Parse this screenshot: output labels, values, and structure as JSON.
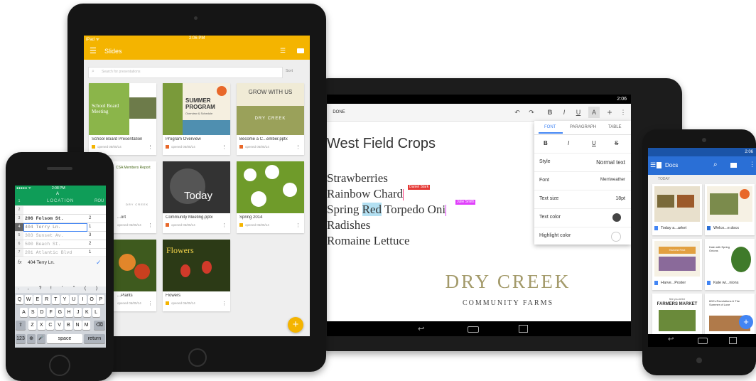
{
  "tablet_android": {
    "status_time": "2:06",
    "toolbar": {
      "done_label": "DONE",
      "bold": "B",
      "italic": "I",
      "underline": "U",
      "text_format": "A",
      "add": "+",
      "more": "⋮",
      "undo": "↶",
      "redo": "↷"
    },
    "document": {
      "title": "West Field Crops",
      "lines": [
        "Strawberries",
        "Rainbow Chard",
        "Spring ",
        "Red",
        " Torpedo Oni",
        "Radishes",
        "Romaine Lettuce"
      ],
      "collab_tags": [
        {
          "name": "Daniel Stark",
          "color": "#e53935"
        },
        {
          "name": "Julie Smith",
          "color": "#e040fb"
        }
      ],
      "logo_main": "DRY CREEK",
      "logo_sub": "COMMUNITY FARMS"
    },
    "format_panel": {
      "tabs": [
        "FONT",
        "PARAGRAPH",
        "TABLE"
      ],
      "style_buttons": [
        "B",
        "I",
        "U",
        "S"
      ],
      "rows": [
        {
          "label": "Style",
          "value": "Normal text"
        },
        {
          "label": "Font",
          "value": "Merriweather"
        },
        {
          "label": "Text size",
          "value": "18pt"
        },
        {
          "label": "Text color",
          "value": ""
        },
        {
          "label": "Highlight color",
          "value": ""
        }
      ]
    },
    "colors": {
      "accent": "#4285f4",
      "tag_red": "#e53935",
      "tag_pink": "#e040fb",
      "logo": "#a39a6a"
    }
  },
  "ipad": {
    "status_left": "iPad ᯤ",
    "status_time": "2:06 PM",
    "app_title": "Slides",
    "search_placeholder": "Search for presentations",
    "sort_label": "Sort",
    "cards": [
      {
        "title": "School Board Presentation",
        "sub": "opened 06/05/14"
      },
      {
        "title": "Program Overview",
        "sub": "opened 06/05/14"
      },
      {
        "title": "Become a C...ember.pptx",
        "sub": "opened 06/05/14"
      },
      {
        "title": "...ort",
        "sub": "opened 06/05/14"
      },
      {
        "title": "Community Meeting.pptx",
        "sub": "opened 06/05/14"
      },
      {
        "title": "Spring 2014",
        "sub": "opened 06/05/14"
      },
      {
        "title": "...Plants",
        "sub": "opened 06/05/14"
      },
      {
        "title": "Flowers",
        "sub": "opened 06/05/14"
      }
    ],
    "thumb_text": {
      "school_board": "School Board Meeting",
      "summer": "SUMMER PROGRAM",
      "summer_sub": "Overview & Schedule",
      "grow": "GROW WITH US",
      "dry_creek": "DRY CREEK",
      "csa": "CSA Members Report",
      "today": "Today",
      "flowers": "Flowers"
    },
    "fab": "+",
    "colors": {
      "accent": "#f4b400"
    }
  },
  "iphone": {
    "carrier": "●●●●● ᯤ",
    "status_time": "2:08 PM",
    "col_a": "A",
    "col_b": "LOCATION",
    "col_c": "ROU",
    "rows": [
      {
        "n": "1",
        "a": "",
        "b": ""
      },
      {
        "n": "2",
        "a": "",
        "b": ""
      },
      {
        "n": "3",
        "a": "206 Folsom St.",
        "b": "2"
      },
      {
        "n": "4",
        "a": "404 Terry Ln.",
        "b": "1"
      },
      {
        "n": "5",
        "a": "303 Sunset Av.",
        "b": "3"
      },
      {
        "n": "6",
        "a": "500 Beach St.",
        "b": "2"
      },
      {
        "n": "7",
        "a": "201 Atlantic Blvd",
        "b": "1"
      }
    ],
    "formula_icon": "fx",
    "formula_value": "404 Terry Ln.",
    "keyboard": {
      "symbols": [
        ".",
        ",",
        "?",
        "!",
        "'",
        "\"",
        "(",
        ")"
      ],
      "row1": [
        "Q",
        "W",
        "E",
        "R",
        "T",
        "Y",
        "U",
        "I",
        "O",
        "P"
      ],
      "row2": [
        "A",
        "S",
        "D",
        "F",
        "G",
        "H",
        "J",
        "K",
        "L"
      ],
      "row3": [
        "Z",
        "X",
        "C",
        "V",
        "B",
        "N",
        "M"
      ],
      "num": "123",
      "space": "space",
      "return": "return"
    }
  },
  "nexus": {
    "status_time": "2:06",
    "app_title": "Docs",
    "section": "TODAY",
    "cards": [
      {
        "title": "Today a...arket"
      },
      {
        "title": "Welco...e.docx"
      },
      {
        "title": "Harve...Poster"
      },
      {
        "title": "Kale wi...nions"
      }
    ],
    "thumb_text": {
      "harvest": "Harvest Fest",
      "kale": "Kale with Spring Onions",
      "farmers": "FARMERS MARKET",
      "farmers_sub": "See you at the",
      "revolutions": "600's Revolutions & The Summer of Love"
    },
    "fab": "+",
    "colors": {
      "accent": "#2a6fd6",
      "sheets": "#0f9d58",
      "docs": "#4285f4",
      "slides": "#f4b400"
    }
  }
}
